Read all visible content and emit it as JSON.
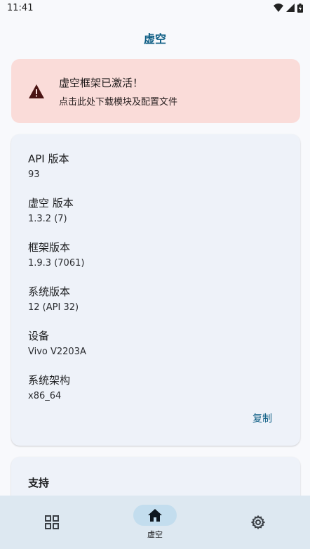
{
  "status_bar": {
    "time": "11:41"
  },
  "app": {
    "title": "虚空"
  },
  "warning": {
    "title": "虚空框架已激活！",
    "subtitle": "点击此处下载模块及配置文件"
  },
  "info": {
    "items": [
      {
        "label": "API 版本",
        "value": "93"
      },
      {
        "label": "虚空 版本",
        "value": "1.3.2 (7)"
      },
      {
        "label": "框架版本",
        "value": "1.9.3 (7061)"
      },
      {
        "label": "系统版本",
        "value": "12 (API 32)"
      },
      {
        "label": "设备",
        "value": "Vivo V2203A"
      },
      {
        "label": "系统架构",
        "value": "x86_64"
      }
    ],
    "copy_label": "复制"
  },
  "support": {
    "title": "支持"
  },
  "nav": {
    "items": [
      {
        "icon": "grid-icon"
      },
      {
        "icon": "home-icon",
        "label": "虚空",
        "active": true
      },
      {
        "icon": "gear-icon"
      }
    ]
  },
  "colors": {
    "accent": "#0b5c83",
    "warning_bg": "#fadcd9",
    "card_bg": "#eef2f9",
    "nav_bg": "#dde8f1"
  }
}
